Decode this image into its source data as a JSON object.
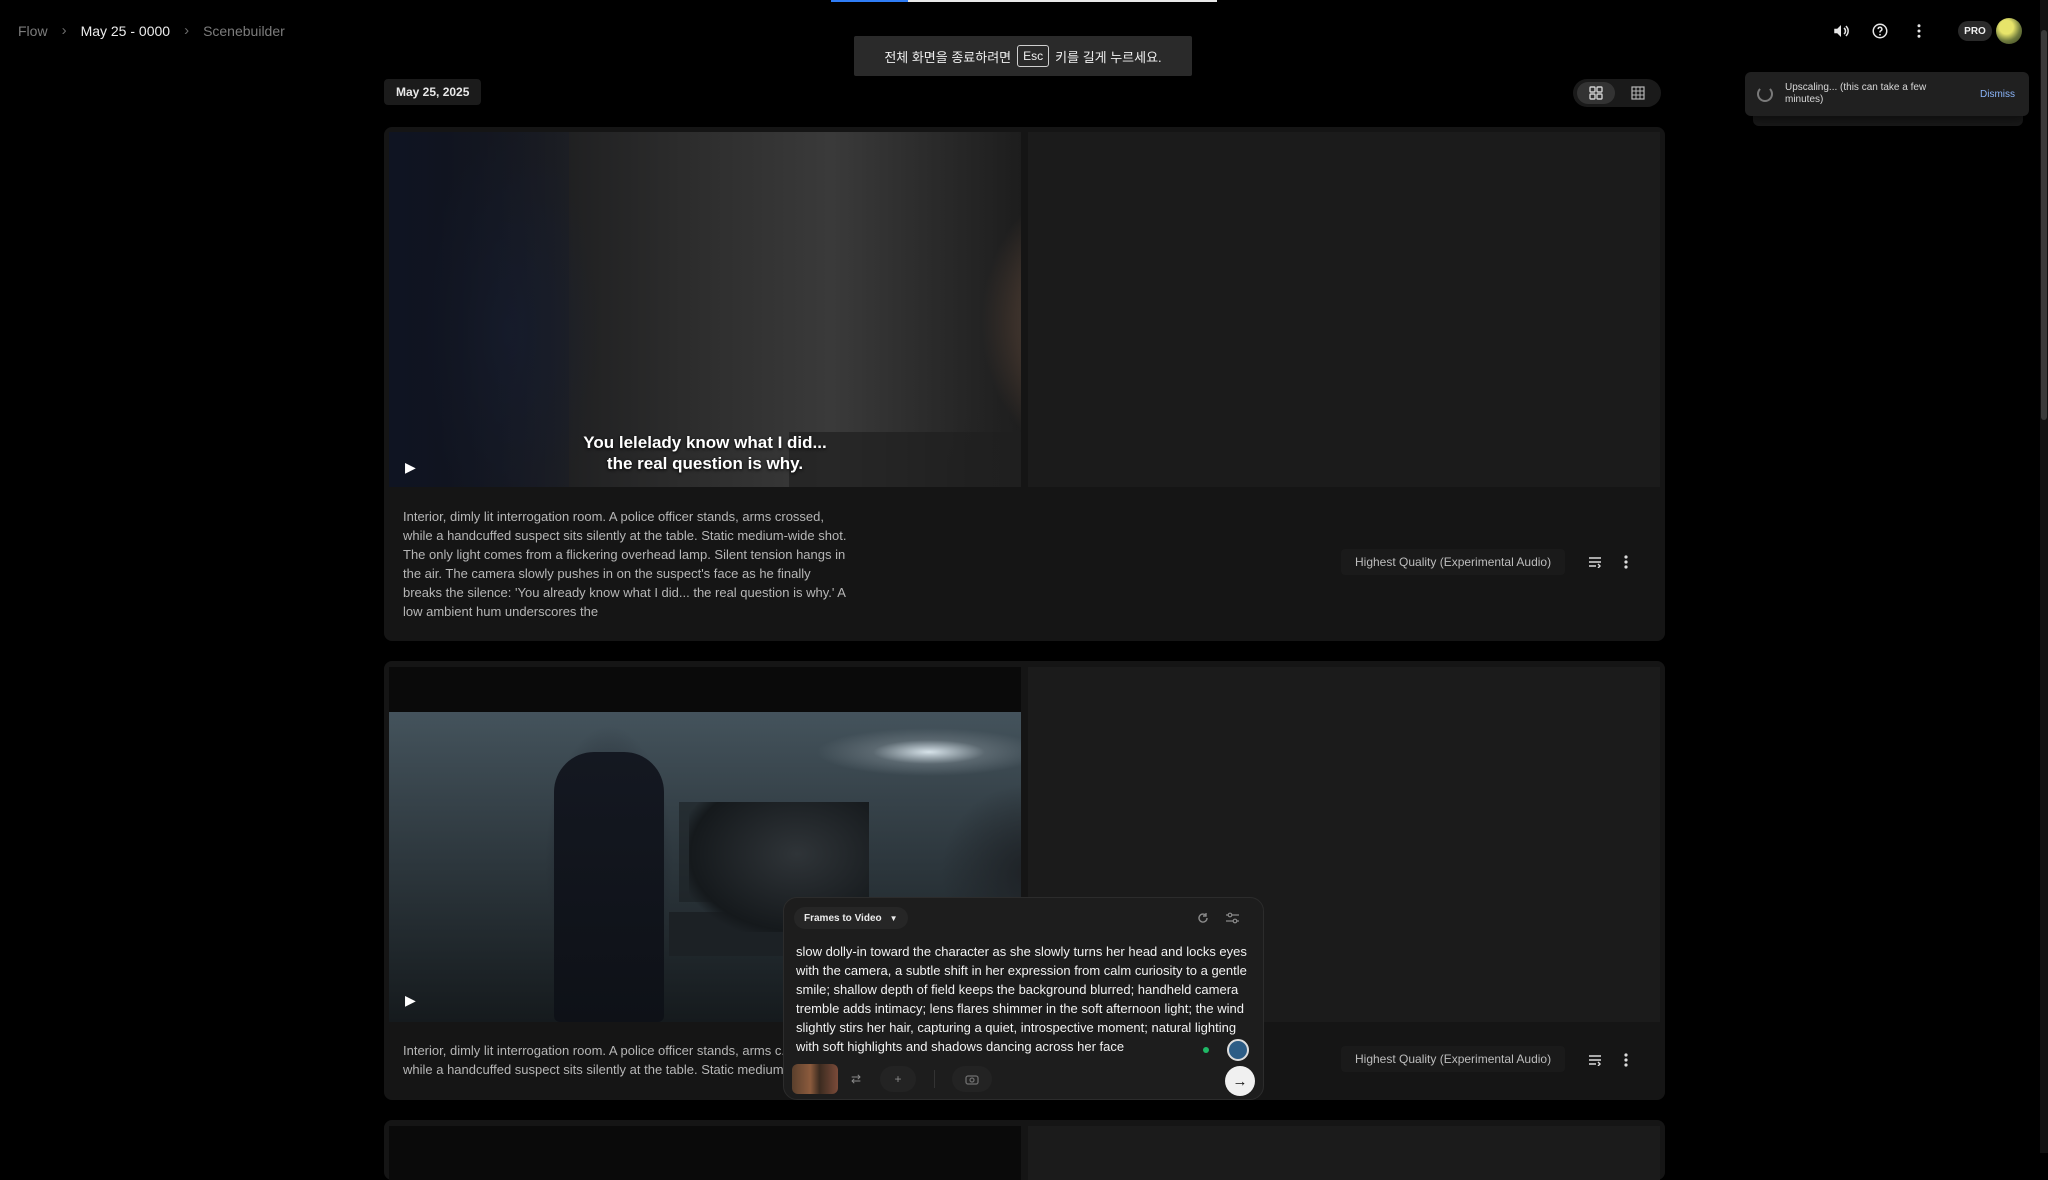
{
  "progress": {
    "fraction": 0.2
  },
  "breadcrumb": {
    "items": [
      "Flow",
      "May 25 - 0000",
      "Scenebuilder"
    ]
  },
  "fullscreen_notice": {
    "before": "전체 화면을 종료하려면",
    "key": "Esc",
    "after": "키를 길게 누르세요."
  },
  "header": {
    "pro_label": "PRO",
    "icons": [
      "volume-icon",
      "help-icon",
      "more-vert-icon"
    ]
  },
  "toast": {
    "text": "Upscaling... (this can take a few minutes)",
    "dismiss": "Dismiss"
  },
  "date_label": "May 25, 2025",
  "clips": [
    {
      "caption_line1": "You lelelady know what I did...",
      "caption_line2": "the real question is why.",
      "description": "Interior, dimly lit interrogation room. A police officer stands, arms crossed, while a handcuffed suspect sits silently at the table. Static medium-wide shot. The only light comes from a flickering overhead lamp. Silent tension hangs in the air. The camera slowly pushes in on the suspect's face as he finally breaks the silence: 'You already know what I did... the real question is why.' A low ambient hum underscores the",
      "quality": "Highest Quality (Experimental Audio)"
    },
    {
      "description": "Interior, dimly lit interrogation room. A police officer stands, arms c... while a handcuffed suspect sits silently at the table. Static medium",
      "quality": "Highest Quality (Experimental Audio)"
    }
  ],
  "prompt_panel": {
    "mode": "Frames to Video",
    "text": "slow dolly-in toward the character as she slowly turns her head and locks eyes with the camera, a subtle shift in her expression from calm curiosity to a gentle smile; shallow depth of field keeps the background blurred; handheld camera tremble adds intimacy; lens flares shimmer in the soft afternoon light; the wind slightly stirs her hair, capturing a quiet, introspective moment; natural lighting with soft highlights and shadows dancing across her face"
  },
  "colors": {
    "background": "#000000",
    "card": "#151515",
    "accent": "#2f7df6",
    "link": "#8ab4f8"
  }
}
